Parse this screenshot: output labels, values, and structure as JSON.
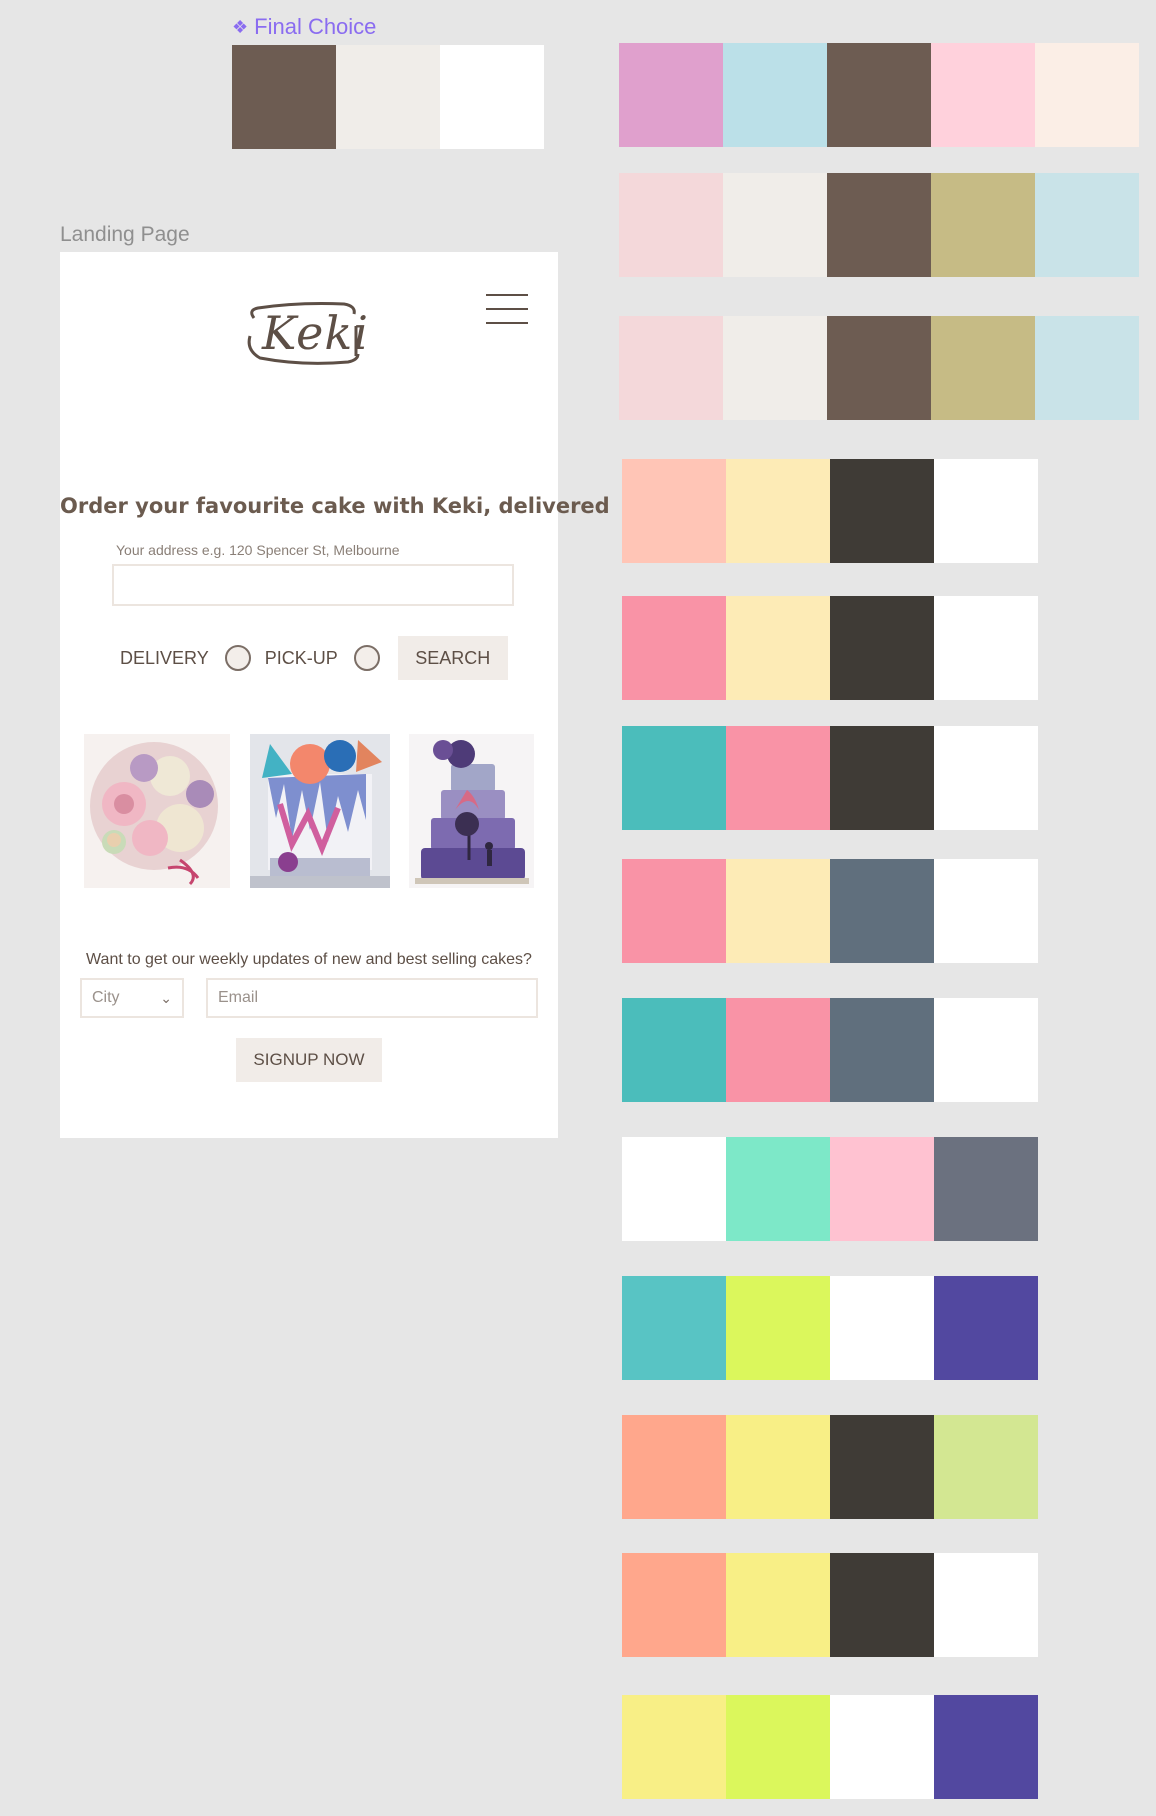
{
  "final_choice": {
    "label": "Final Choice",
    "colors": [
      "#6d5c52",
      "#f0ede9",
      "#ffffff"
    ]
  },
  "frame_label": "Landing Page",
  "landing": {
    "logo": "Keki",
    "headline": "Order your favourite cake with Keki, delivered",
    "address_label": "Your address e.g. 120 Spencer St, Melbourne",
    "address_value": "",
    "delivery_label": "DELIVERY",
    "pickup_label": "PICK-UP",
    "search_label": "SEARCH",
    "newsletter_text": "Want to get our weekly updates of new and best selling cakes?",
    "city_label": "City",
    "email_placeholder": "Email",
    "signup_label": "SIGNUP NOW"
  },
  "palettes": [
    [
      "#e0a0cd",
      "#bbe0e8",
      "#6d5c52",
      "#ffd1dc",
      "#fbeee6"
    ],
    [
      "#f4d8da",
      "#f0ede9",
      "#6d5c52",
      "#c6bb85",
      "#c9e3e8"
    ],
    [
      "#f4d8da",
      "#f0ede9",
      "#6d5c52",
      "#c6bb85",
      "#c9e3e8"
    ],
    [
      "#ffc5b6",
      "#fdebb6",
      "#3f3b36",
      "#ffffff"
    ],
    [
      "#f993a6",
      "#fdebb6",
      "#3f3b36",
      "#ffffff"
    ],
    [
      "#4bbdbb",
      "#f993a6",
      "#3f3b36",
      "#ffffff"
    ],
    [
      "#f993a6",
      "#fdebb6",
      "#606f7d",
      "#ffffff"
    ],
    [
      "#4bbdbb",
      "#f993a6",
      "#606f7d",
      "#ffffff"
    ],
    [
      "#ffffff",
      "#7de8c8",
      "#ffc2d1",
      "#6b717f"
    ],
    [
      "#58c4c4",
      "#dbf75c",
      "#ffffff",
      "#5248a0"
    ],
    [
      "#ffa78c",
      "#f8ef86",
      "#3f3b36",
      "#d3e792"
    ],
    [
      "#ffa78c",
      "#f8ef86",
      "#3f3b36",
      "#ffffff"
    ],
    [
      "#f8ef86",
      "#dbf75c",
      "#ffffff",
      "#5248a0"
    ]
  ]
}
